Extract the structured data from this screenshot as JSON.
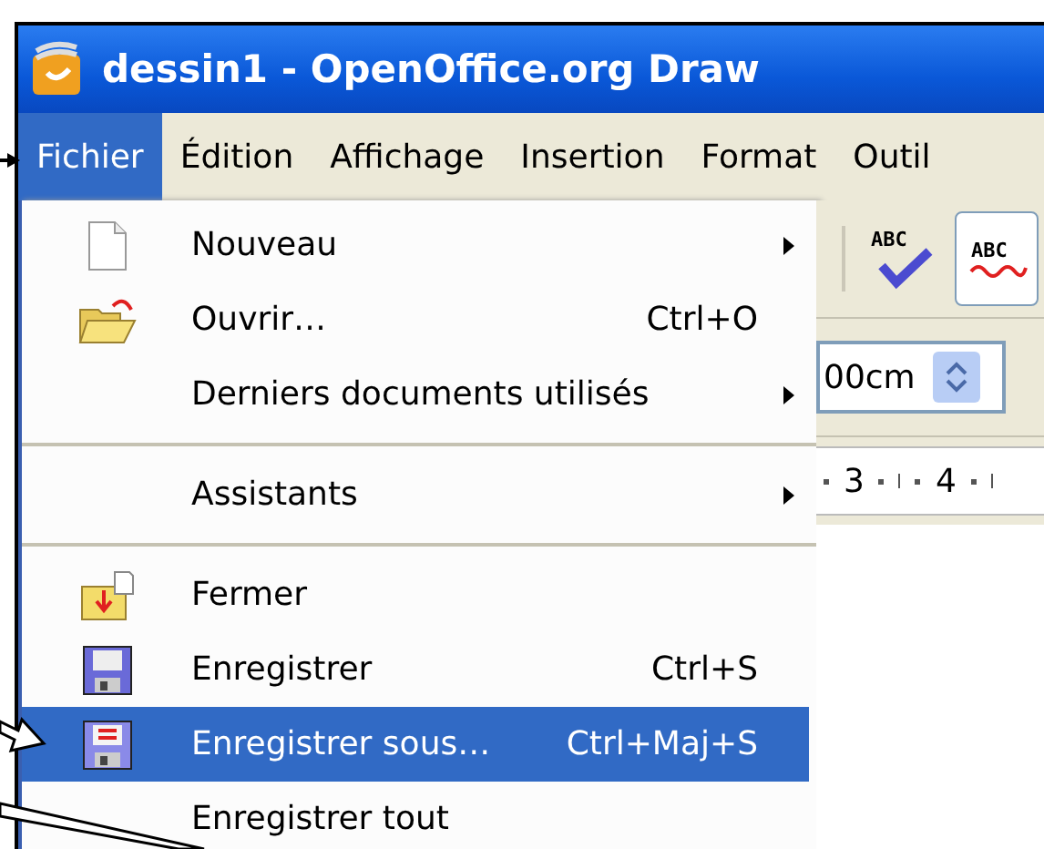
{
  "window": {
    "title": "dessin1 - OpenOffice.org Draw"
  },
  "menubar": [
    {
      "label": "Fichier",
      "selected": true
    },
    {
      "label": "Édition",
      "selected": false
    },
    {
      "label": "Affichage",
      "selected": false
    },
    {
      "label": "Insertion",
      "selected": false
    },
    {
      "label": "Format",
      "selected": false
    },
    {
      "label": "Outil",
      "selected": false
    }
  ],
  "menu": [
    {
      "kind": "item",
      "label": "Nouveau",
      "submenu": true,
      "selected": false
    },
    {
      "kind": "item",
      "label": "Ouvrir…",
      "shortcut": "Ctrl+O",
      "submenu": false,
      "selected": false
    },
    {
      "kind": "item",
      "label": "Derniers documents utilisés",
      "submenu": true,
      "selected": false
    },
    {
      "kind": "separator"
    },
    {
      "kind": "item",
      "label": "Assistants",
      "submenu": true,
      "selected": false
    },
    {
      "kind": "separator"
    },
    {
      "kind": "item",
      "label": "Fermer",
      "submenu": false,
      "selected": false
    },
    {
      "kind": "item",
      "label": "Enregistrer",
      "shortcut": "Ctrl+S",
      "submenu": false,
      "selected": false
    },
    {
      "kind": "item",
      "label": "Enregistrer sous…",
      "shortcut": "Ctrl+Maj+S",
      "submenu": false,
      "selected": true
    },
    {
      "kind": "item",
      "label": "Enregistrer tout",
      "submenu": false,
      "selected": false
    }
  ],
  "spellcheck_button": {
    "label": "ABC"
  },
  "autospellcheck_button": {
    "label": "ABC"
  },
  "size_field": {
    "value": "00cm"
  },
  "ruler": [
    "3",
    "4"
  ]
}
